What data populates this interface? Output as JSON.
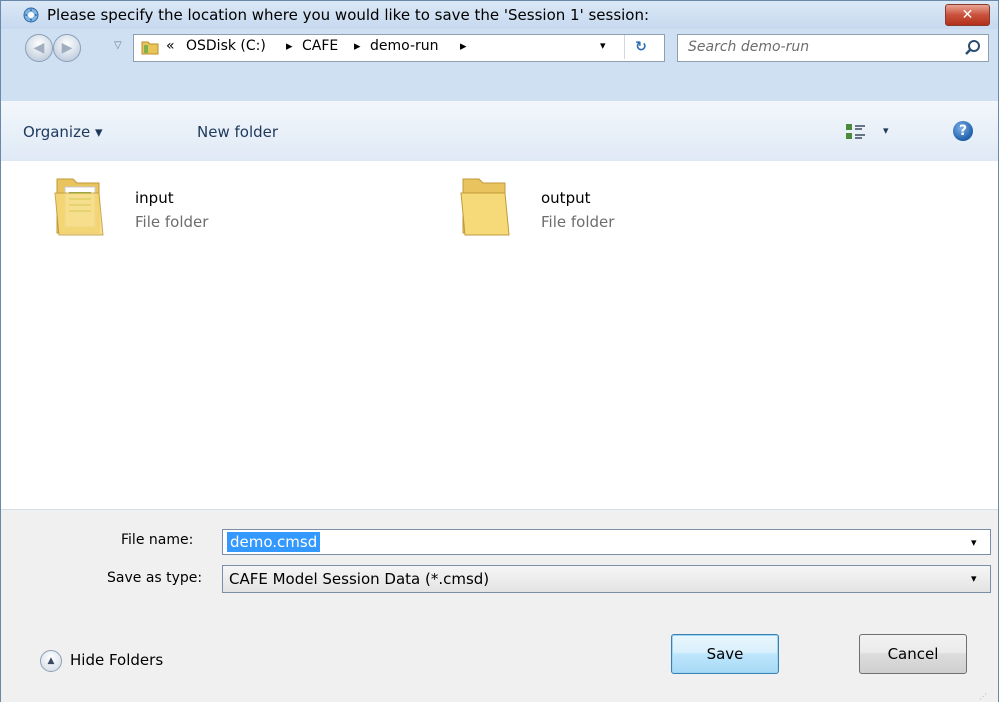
{
  "window": {
    "title": "Please specify the location where you would like to save the 'Session 1' session:",
    "close_glyph": "✕"
  },
  "address": {
    "overflow_glyph": "«",
    "crumbs": [
      "OSDisk (C:)",
      "CAFE",
      "demo-run"
    ],
    "chevron": "▸",
    "dropdown_glyph": "▾",
    "refresh_glyph": "↻"
  },
  "search": {
    "placeholder": "Search demo-run"
  },
  "toolbar": {
    "organize_label": "Organize ▾",
    "new_folder_label": "New folder",
    "views_caret": "▾",
    "help_glyph": "?"
  },
  "files": [
    {
      "name": "input",
      "type": "File folder"
    },
    {
      "name": "output",
      "type": "File folder"
    }
  ],
  "form": {
    "filename_label": "File name:",
    "filename_value": "demo.cmsd",
    "savetype_label": "Save as type:",
    "savetype_value": "CAFE Model Session Data (*.cmsd)",
    "dropdown_glyph": "▾"
  },
  "footer": {
    "hide_folders_label": "Hide Folders",
    "hide_glyph": "▲",
    "save_label": "Save",
    "cancel_label": "Cancel",
    "grip": "⋰"
  },
  "colors": {
    "accent": "#3399ff",
    "frame": "#cfe0f2",
    "close": "#c9523b"
  }
}
